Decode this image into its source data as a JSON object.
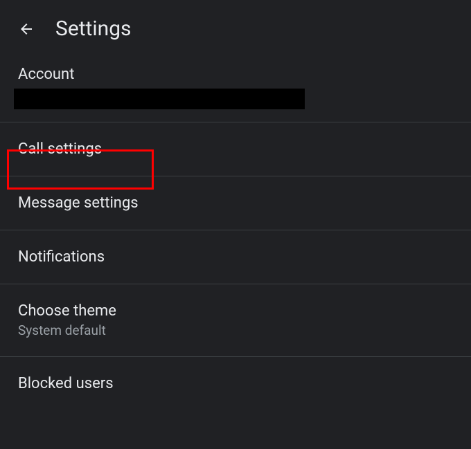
{
  "header": {
    "title": "Settings"
  },
  "account": {
    "label": "Account"
  },
  "items": [
    {
      "title": "Call settings",
      "subtitle": null
    },
    {
      "title": "Message settings",
      "subtitle": null
    },
    {
      "title": "Notifications",
      "subtitle": null
    },
    {
      "title": "Choose theme",
      "subtitle": "System default"
    },
    {
      "title": "Blocked users",
      "subtitle": null
    }
  ]
}
